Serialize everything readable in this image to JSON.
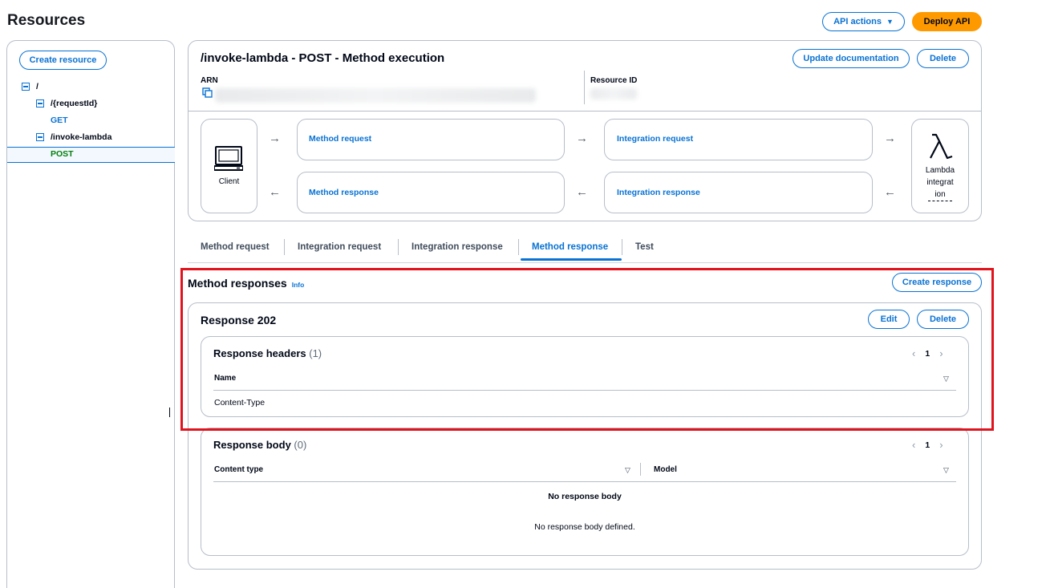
{
  "page": {
    "title": "Resources"
  },
  "header": {
    "api_actions_label": "API actions",
    "deploy_label": "Deploy API"
  },
  "sidebar": {
    "create_resource_label": "Create resource",
    "tree": [
      {
        "label": "/",
        "level": 0,
        "type": "resource"
      },
      {
        "label": "/{requestId}",
        "level": 1,
        "type": "resource"
      },
      {
        "label": "GET",
        "level": 2,
        "type": "method"
      },
      {
        "label": "/invoke-lambda",
        "level": 1,
        "type": "resource"
      },
      {
        "label": "POST",
        "level": 2,
        "type": "method",
        "selected": true
      }
    ]
  },
  "execution": {
    "title": "/invoke-lambda - POST - Method execution",
    "update_doc_label": "Update documentation",
    "delete_label": "Delete",
    "arn_label": "ARN",
    "resource_id_label": "Resource ID",
    "flow": {
      "client_label": "Client",
      "method_request": "Method request",
      "integration_request": "Integration request",
      "method_response": "Method response",
      "integration_response": "Integration response",
      "lambda_label": "Lambda integration",
      "lambda_line1": "Lambda",
      "lambda_line2": "integrat",
      "lambda_line3": "ion"
    }
  },
  "tabs": [
    {
      "label": "Method request",
      "active": false
    },
    {
      "label": "Integration request",
      "active": false
    },
    {
      "label": "Integration response",
      "active": false
    },
    {
      "label": "Method response",
      "active": true
    },
    {
      "label": "Test",
      "active": false
    }
  ],
  "method_responses": {
    "heading": "Method responses",
    "info_label": "Info",
    "create_label": "Create response",
    "response": {
      "title": "Response 202",
      "edit_label": "Edit",
      "delete_label": "Delete",
      "headers": {
        "title": "Response headers",
        "count": "(1)",
        "page": "1",
        "column_name": "Name",
        "rows": [
          "Content-Type"
        ]
      },
      "body": {
        "title": "Response body",
        "count": "(0)",
        "page": "1",
        "column_content_type": "Content type",
        "column_model": "Model",
        "empty_title": "No response body",
        "empty_desc": "No response body defined."
      }
    }
  },
  "colors": {
    "accent": "#0972d3",
    "primary_button": "#ff9900",
    "highlight": "#e0141e",
    "border": "#b6bec9"
  }
}
